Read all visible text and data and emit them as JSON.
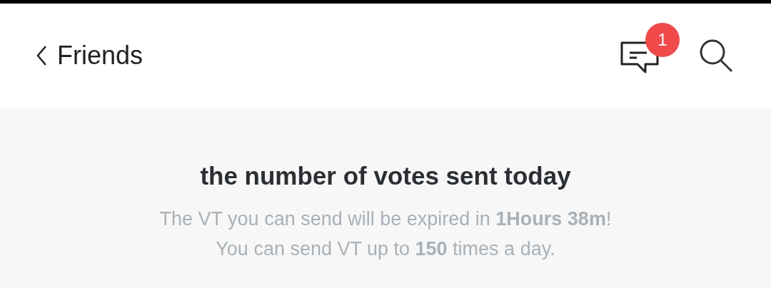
{
  "header": {
    "back_label": "Friends",
    "messages_badge": "1"
  },
  "votes": {
    "title": "the number of votes sent today",
    "lines": [
      "The VT you can send will be expired in **1Hours 38m**!",
      "You can send VT up to **150** times a day."
    ]
  }
}
